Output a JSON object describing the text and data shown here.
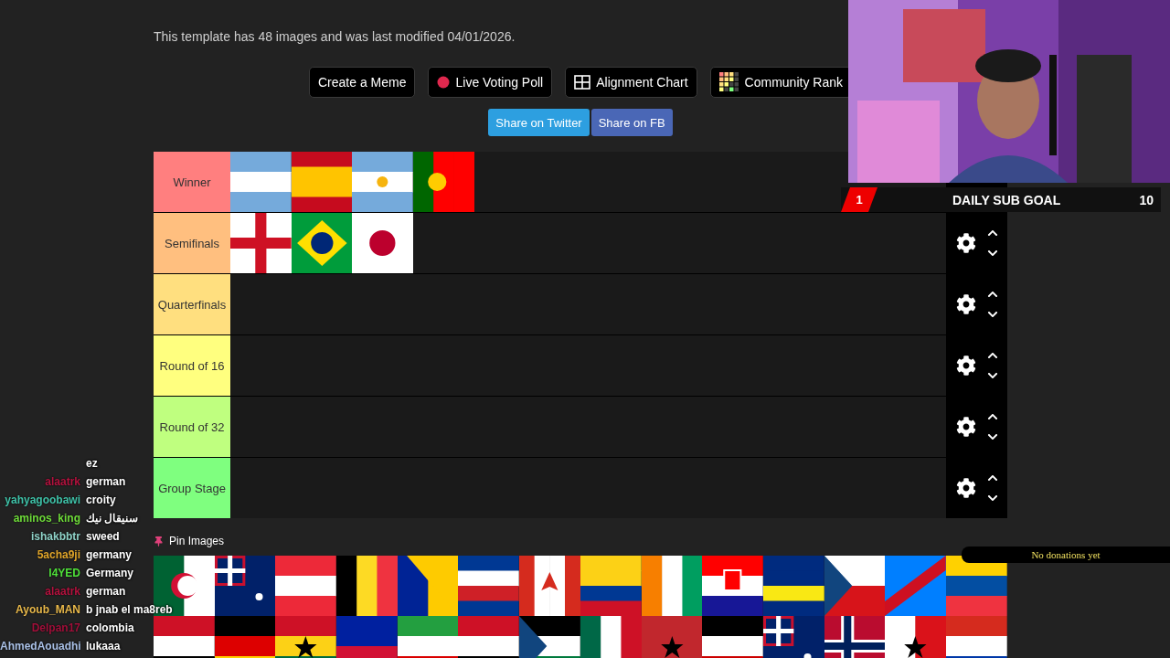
{
  "info": "This template has 48 images and was last modified 04/01/2026.",
  "actions": [
    {
      "label": "Create a Meme",
      "kind": "plain"
    },
    {
      "label": "Live Voting Poll",
      "kind": "dot"
    },
    {
      "label": "Alignment Chart",
      "kind": "grid"
    },
    {
      "label": "Community Rank",
      "kind": "mosaic"
    }
  ],
  "share": [
    {
      "label": "Share on Twitter",
      "color": "#2d9fe0"
    },
    {
      "label": "Share on FB",
      "color": "#4a67b6"
    }
  ],
  "tiers": [
    {
      "label": "Winner",
      "color": "#ff7f7f",
      "controls": false
    },
    {
      "label": "Semifinals",
      "color": "#ffbf7f",
      "controls": true
    },
    {
      "label": "Quarterfinals",
      "color": "#ffdf7f",
      "controls": true
    },
    {
      "label": "Round of 16",
      "color": "#ffff7f",
      "controls": true
    },
    {
      "label": "Round of 32",
      "color": "#bfff7f",
      "controls": true
    },
    {
      "label": "Group Stage",
      "color": "#7fff7f",
      "controls": true
    }
  ],
  "pin_label": "Pin Images",
  "sub_goal": {
    "count": "1",
    "title": "DAILY SUB GOAL",
    "target": "10"
  },
  "donations": "No donations yet",
  "chat": [
    {
      "text": "ez"
    },
    {
      "user": "alaatrk",
      "text": "german",
      "color": "#b3123e"
    },
    {
      "user": "yahyagoobawi",
      "text": "croity",
      "color": "#3fc2a8"
    },
    {
      "user": "aminos_king",
      "text": "سنيقال نيك",
      "color": "#6fdc3a"
    },
    {
      "user": "ishakbbtr",
      "text": "sweed",
      "color": "#8fd3c9"
    },
    {
      "user": "5acha9ji",
      "text": "germany",
      "color": "#e0a52a"
    },
    {
      "user": "I4YED",
      "text": "Germany",
      "color": "#4fe03a"
    },
    {
      "user": "alaatrk",
      "text": "german",
      "color": "#b3123e"
    },
    {
      "user": "Ayoub_MAN",
      "text": "b jnab el ma8reb",
      "color": "#e8b84a"
    },
    {
      "user": "Delpan17",
      "text": "colombia",
      "color": "#a0103a"
    },
    {
      "user": "AhmedAouadhi",
      "text": "lukaaa",
      "color": "#a9c0e6"
    }
  ]
}
